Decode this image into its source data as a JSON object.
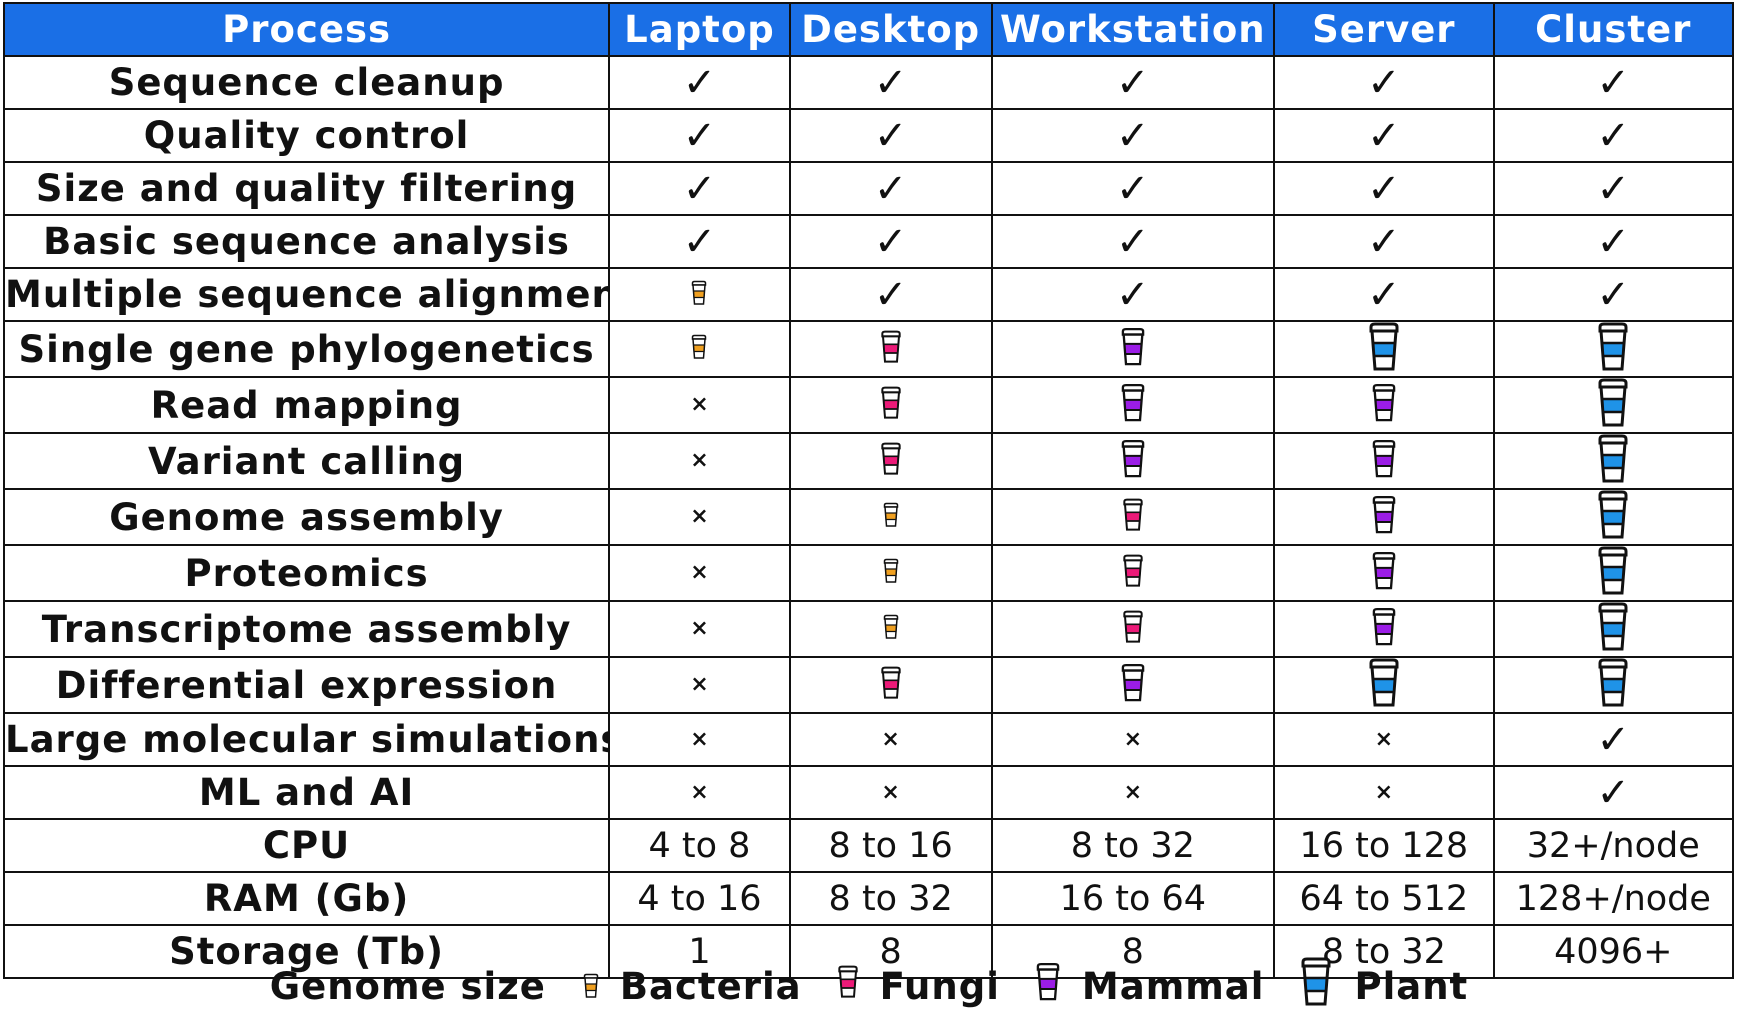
{
  "table": {
    "headers": [
      "Process",
      "Laptop",
      "Desktop",
      "Workstation",
      "Server",
      "Cluster"
    ],
    "rows": [
      {
        "process": "Sequence cleanup",
        "cells": [
          "check",
          "check",
          "check",
          "check",
          "check"
        ]
      },
      {
        "process": "Quality control",
        "cells": [
          "check",
          "check",
          "check",
          "check",
          "check"
        ]
      },
      {
        "process": "Size and quality filtering",
        "cells": [
          "check",
          "check",
          "check",
          "check",
          "check"
        ]
      },
      {
        "process": "Basic sequence analysis",
        "cells": [
          "check",
          "check",
          "check",
          "check",
          "check"
        ]
      },
      {
        "process": "Multiple sequence alignment",
        "cells": [
          "bacteria",
          "check",
          "check",
          "check",
          "check"
        ]
      },
      {
        "process": "Single gene phylogenetics",
        "cells": [
          "bacteria",
          "fungi",
          "mammal",
          "plant",
          "plant"
        ]
      },
      {
        "process": "Read mapping",
        "cells": [
          "cross",
          "fungi",
          "mammal",
          "mammal",
          "plant"
        ]
      },
      {
        "process": "Variant calling",
        "cells": [
          "cross",
          "fungi",
          "mammal",
          "mammal",
          "plant"
        ]
      },
      {
        "process": "Genome assembly",
        "cells": [
          "cross",
          "bacteria",
          "fungi",
          "mammal",
          "plant"
        ]
      },
      {
        "process": "Proteomics",
        "cells": [
          "cross",
          "bacteria",
          "fungi",
          "mammal",
          "plant"
        ]
      },
      {
        "process": "Transcriptome assembly",
        "cells": [
          "cross",
          "bacteria",
          "fungi",
          "mammal",
          "plant"
        ]
      },
      {
        "process": "Differential expression",
        "cells": [
          "cross",
          "fungi",
          "mammal",
          "plant",
          "plant"
        ]
      },
      {
        "process": "Large molecular simulations",
        "cells": [
          "cross",
          "cross",
          "cross",
          "cross",
          "check"
        ]
      },
      {
        "process": "ML and AI",
        "cells": [
          "cross",
          "cross",
          "cross",
          "cross",
          "check"
        ]
      },
      {
        "process": "CPU",
        "cells": [
          "4 to 8",
          "8 to 16",
          "8 to 32",
          "16 to 128",
          "32+/node"
        ]
      },
      {
        "process": "RAM (Gb)",
        "cells": [
          "4 to 16",
          "8 to 32",
          "16 to 64",
          "64 to 512",
          "128+/node"
        ]
      },
      {
        "process": "Storage (Tb)",
        "cells": [
          "1",
          "8",
          "8",
          "8 to 32",
          "4096+"
        ]
      }
    ]
  },
  "symbols": {
    "check": "✓",
    "cross": "×",
    "bacteria": {
      "icon": "coffee-cup-icon",
      "color": "#f0a020",
      "size": "small"
    },
    "fungi": {
      "icon": "coffee-cup-icon",
      "color": "#ec1a78",
      "size": "medium"
    },
    "mammal": {
      "icon": "coffee-cup-icon",
      "color": "#9b1de6",
      "size": "large"
    },
    "plant": {
      "icon": "coffee-cup-icon",
      "color": "#1f93e8",
      "size": "xlarge"
    }
  },
  "legend": {
    "title": "Genome size",
    "items": [
      {
        "key": "bacteria",
        "label": "Bacteria"
      },
      {
        "key": "fungi",
        "label": "Fungi"
      },
      {
        "key": "mammal",
        "label": "Mammal"
      },
      {
        "key": "plant",
        "label": "Plant"
      }
    ]
  },
  "colors": {
    "header_bg": "#1a6fe6",
    "header_text": "#ffffff",
    "border": "#111111"
  }
}
